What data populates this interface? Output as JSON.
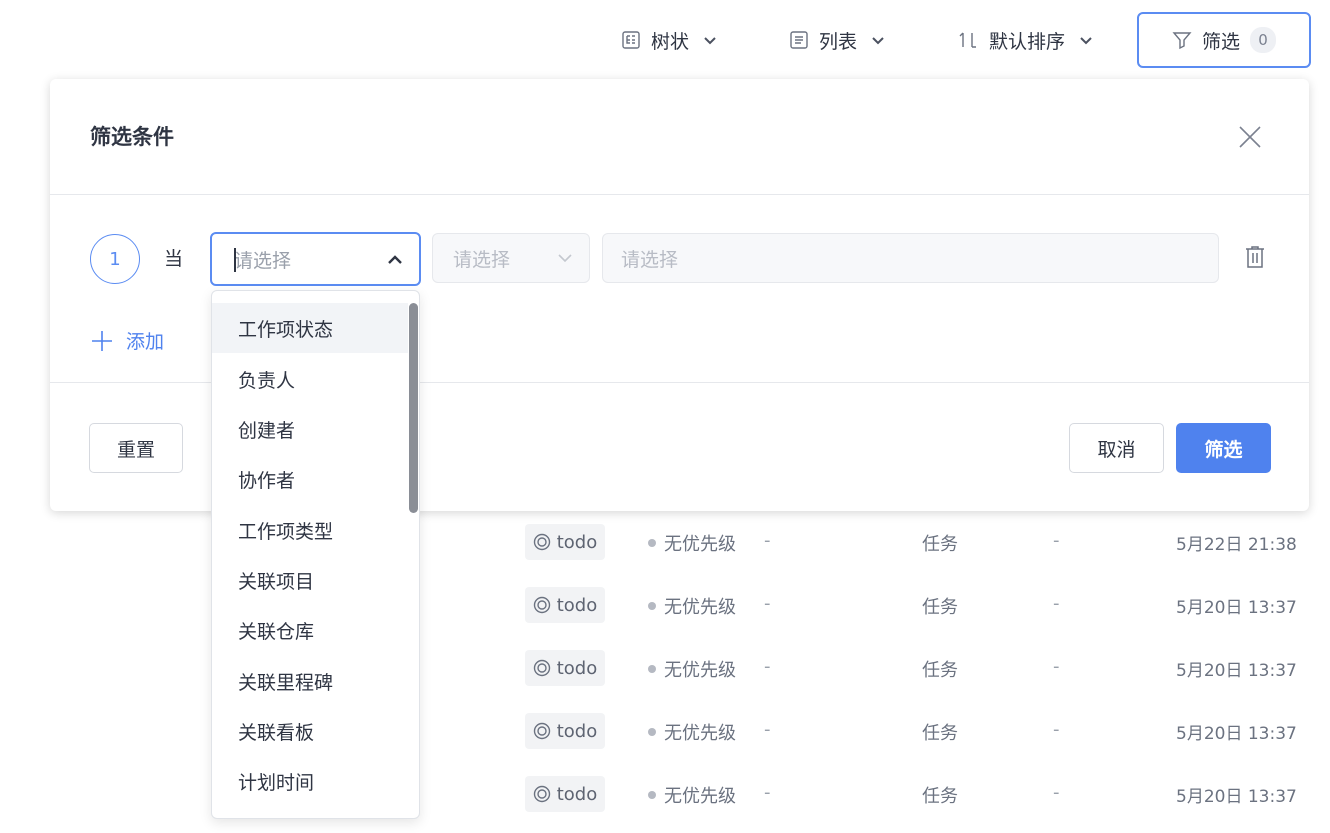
{
  "toolbar": {
    "tree_label": "树状",
    "list_label": "列表",
    "sort_label": "默认排序",
    "filter_label": "筛选",
    "filter_count": "0"
  },
  "table_rows": [
    {
      "state": "todo",
      "priority": "无优先级",
      "col_a": "-",
      "type": "任务",
      "col_b": "-",
      "time": "5月22日 21:38"
    },
    {
      "state": "todo",
      "priority": "无优先级",
      "col_a": "-",
      "type": "任务",
      "col_b": "-",
      "time": "5月20日 13:37"
    },
    {
      "state": "todo",
      "priority": "无优先级",
      "col_a": "-",
      "type": "任务",
      "col_b": "-",
      "time": "5月20日 13:37"
    },
    {
      "state": "todo",
      "priority": "无优先级",
      "col_a": "-",
      "type": "任务",
      "col_b": "-",
      "time": "5月20日 13:37"
    },
    {
      "state": "todo",
      "priority": "无优先级",
      "col_a": "-",
      "type": "任务",
      "col_b": "-",
      "time": "5月20日 13:37"
    }
  ],
  "panel": {
    "title": "筛选条件",
    "condition_number": "1",
    "condition_when": "当",
    "field_placeholder": "请选择",
    "operator_placeholder": "请选择",
    "value_placeholder": "请选择",
    "add_label": "添加",
    "reset_label": "重置",
    "cancel_label": "取消",
    "apply_label": "筛选"
  },
  "dropdown": {
    "items": [
      "工作项状态",
      "负责人",
      "创建者",
      "协作者",
      "工作项类型",
      "关联项目",
      "关联仓库",
      "关联里程碑",
      "关联看板",
      "计划时间"
    ],
    "active_index": 0
  },
  "colors": {
    "accent": "#4f82ee",
    "border_focus": "#5b8cf2",
    "text": "#2f3543"
  }
}
